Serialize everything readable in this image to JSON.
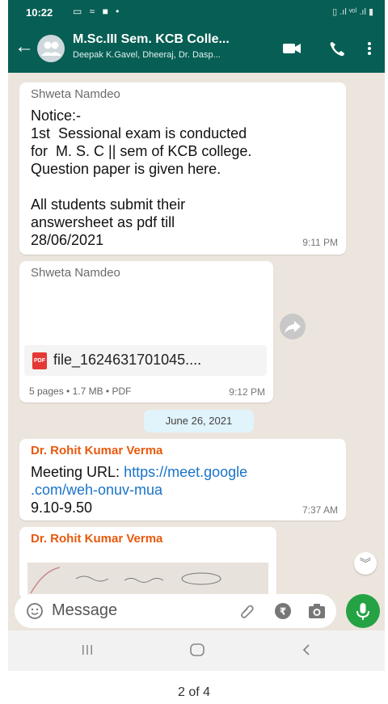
{
  "status_bar": {
    "time": "10:22",
    "icons_text": "▭ ≈ ■ •",
    "right_text": "▯ .ıl ᵛᵒˡ .ıl ▮"
  },
  "header": {
    "title": "M.Sc.III Sem. KCB Colle...",
    "subtitle": "Deepak K.Gavel, Dheeraj, Dr. Dasp..."
  },
  "messages": [
    {
      "sender": "Shweta Namdeo",
      "text": "Notice:-\n1st  Sessional exam is conducted\nfor  M. S. C || sem of KCB college.\nQuestion paper is given here.\n\nAll students submit their\nanswersheet as pdf till\n28/06/2021",
      "time": "9:11 PM"
    },
    {
      "sender": "Shweta Namdeo",
      "file_name": "file_1624631701045....",
      "file_meta": "5 pages • 1.7 MB • PDF",
      "time": "9:12 PM",
      "pdf_badge": "PDF"
    },
    {
      "date_divider": "June 26, 2021"
    },
    {
      "sender": "Dr. Rohit Kumar Verma",
      "text_prefix": "Meeting URL: ",
      "link_line1": "https://meet.google",
      "link_line2": ".com/weh-onuv-mua",
      "text_after": "9.10-9.50",
      "time": "7:37 AM"
    },
    {
      "sender": "Dr. Rohit Kumar Verma"
    }
  ],
  "composer": {
    "placeholder": "Message"
  },
  "pager": "2 of 4",
  "colors": {
    "header": "#075e54",
    "chat_bg": "#ece5dd",
    "mic": "#25a244",
    "sender_accent": "#e8590c",
    "link": "#1a73c9"
  },
  "icons": [
    "back-arrow-icon",
    "group-avatar-icon",
    "video-call-icon",
    "phone-call-icon",
    "more-vert-icon",
    "forward-icon",
    "pdf-icon",
    "scroll-down-icon",
    "emoji-icon",
    "attach-icon",
    "payment-icon",
    "camera-icon",
    "mic-icon",
    "recents-icon",
    "home-icon",
    "back-nav-icon"
  ]
}
